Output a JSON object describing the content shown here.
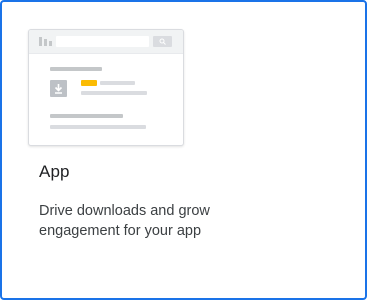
{
  "card": {
    "title": "App",
    "description": "Drive downloads and grow engagement for your app",
    "selected_border_color": "#1a73e8"
  },
  "illustration": {
    "accent_color": "#fbbc04",
    "icons": [
      "search-icon",
      "download-icon"
    ]
  }
}
